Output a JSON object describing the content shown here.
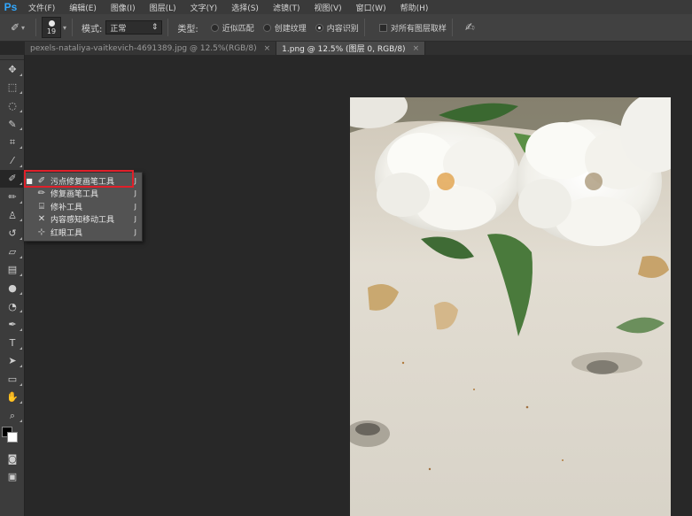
{
  "app": {
    "logo": "Ps",
    "menu": [
      "文件(F)",
      "编辑(E)",
      "图像(I)",
      "图层(L)",
      "文字(Y)",
      "选择(S)",
      "滤镜(T)",
      "视图(V)",
      "窗口(W)",
      "帮助(H)"
    ]
  },
  "options": {
    "brush_size": "19",
    "mode_label": "模式:",
    "mode_value": "正常",
    "type_label": "类型:",
    "type_options": [
      {
        "label": "近似匹配",
        "selected": false
      },
      {
        "label": "创建纹理",
        "selected": false
      },
      {
        "label": "内容识别",
        "selected": true
      }
    ],
    "sample_all_layers": {
      "label": "对所有图层取样",
      "checked": false
    }
  },
  "tabs": [
    {
      "label": "pexels-nataliya-vaitkevich-4691389.jpg @ 12.5%(RGB/8)",
      "close": "×",
      "active": false
    },
    {
      "label": "1.png @ 12.5% (图层 0, RGB/8)",
      "close": "×",
      "active": true
    }
  ],
  "tools": [
    {
      "name": "move-tool",
      "glyph": "✥"
    },
    {
      "name": "marquee-tool",
      "glyph": "⬚"
    },
    {
      "name": "lasso-tool",
      "glyph": "◌"
    },
    {
      "name": "quick-selection-tool",
      "glyph": "✎"
    },
    {
      "name": "crop-tool",
      "glyph": "⌗"
    },
    {
      "name": "eyedropper-tool",
      "glyph": "⁄"
    },
    {
      "name": "spot-healing-brush-tool",
      "glyph": "✐"
    },
    {
      "name": "brush-tool",
      "glyph": "✏"
    },
    {
      "name": "clone-stamp-tool",
      "glyph": "♙"
    },
    {
      "name": "history-brush-tool",
      "glyph": "↺"
    },
    {
      "name": "eraser-tool",
      "glyph": "▱"
    },
    {
      "name": "gradient-tool",
      "glyph": "▤"
    },
    {
      "name": "blur-tool",
      "glyph": "●"
    },
    {
      "name": "dodge-tool",
      "glyph": "◔"
    },
    {
      "name": "pen-tool",
      "glyph": "✒"
    },
    {
      "name": "type-tool",
      "glyph": "T"
    },
    {
      "name": "path-selection-tool",
      "glyph": "➤"
    },
    {
      "name": "rectangle-tool",
      "glyph": "▭"
    },
    {
      "name": "hand-tool",
      "glyph": "✋"
    },
    {
      "name": "zoom-tool",
      "glyph": "⌕"
    }
  ],
  "flyout": {
    "items": [
      {
        "label": "污点修复画笔工具",
        "key": "J",
        "icon": "✐",
        "selected": true
      },
      {
        "label": "修复画笔工具",
        "key": "J",
        "icon": "✏",
        "selected": false
      },
      {
        "label": "修补工具",
        "key": "J",
        "icon": "⌸",
        "selected": false
      },
      {
        "label": "内容感知移动工具",
        "key": "J",
        "icon": "✕",
        "selected": false
      },
      {
        "label": "红眼工具",
        "key": "J",
        "icon": "⊹",
        "selected": false
      }
    ]
  },
  "colors": {
    "foreground": "#000000",
    "background": "#ffffff",
    "highlight": "#e0202a"
  }
}
